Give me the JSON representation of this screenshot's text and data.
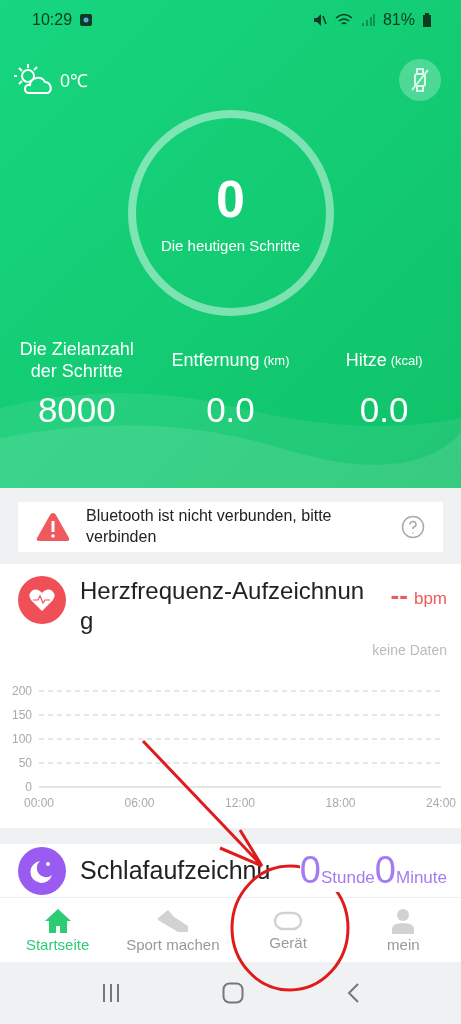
{
  "status_bar": {
    "time": "10:29",
    "battery": "81%"
  },
  "header": {
    "temperature": "0℃",
    "steps": "0",
    "steps_label": "Die heutigen Schritte",
    "stats": [
      {
        "label": "Die Zielanzahl der Schritte",
        "value": "8000"
      },
      {
        "label": "Entfernung",
        "unit": "(km)",
        "value": "0.0"
      },
      {
        "label": "Hitze",
        "unit": "(kcal)",
        "value": "0.0"
      }
    ]
  },
  "alert": {
    "text": "Bluetooth ist nicht verbunden, bitte verbinden"
  },
  "heart_card": {
    "title": "Herzfrequenz-Aufzeichnung",
    "reading": "--",
    "unit": "bpm",
    "status": "keine Daten",
    "chart_data": {
      "type": "line",
      "grid": true,
      "ylim": [
        0,
        200
      ],
      "yticks": [
        0,
        50,
        100,
        150,
        200
      ],
      "xlim": [
        0,
        24
      ],
      "xticks": [
        {
          "value": 0,
          "label": "00:00"
        },
        {
          "value": 6,
          "label": "06:00"
        },
        {
          "value": 12,
          "label": "12:00"
        },
        {
          "value": 18,
          "label": "18:00"
        },
        {
          "value": 24,
          "label": "24:00"
        }
      ]
    }
  },
  "sleep_card": {
    "title": "Schlafaufzeichnu",
    "hours": "0",
    "hours_unit": "Stunde",
    "minutes": "0",
    "minutes_unit": "Minute"
  },
  "tabs": [
    {
      "label": "Startseite",
      "kind": "home",
      "selected": true
    },
    {
      "label": "Sport machen",
      "kind": "shoe",
      "selected": false
    },
    {
      "label": "Gerät",
      "kind": "band",
      "selected": false
    },
    {
      "label": "mein",
      "kind": "person",
      "selected": false
    }
  ]
}
